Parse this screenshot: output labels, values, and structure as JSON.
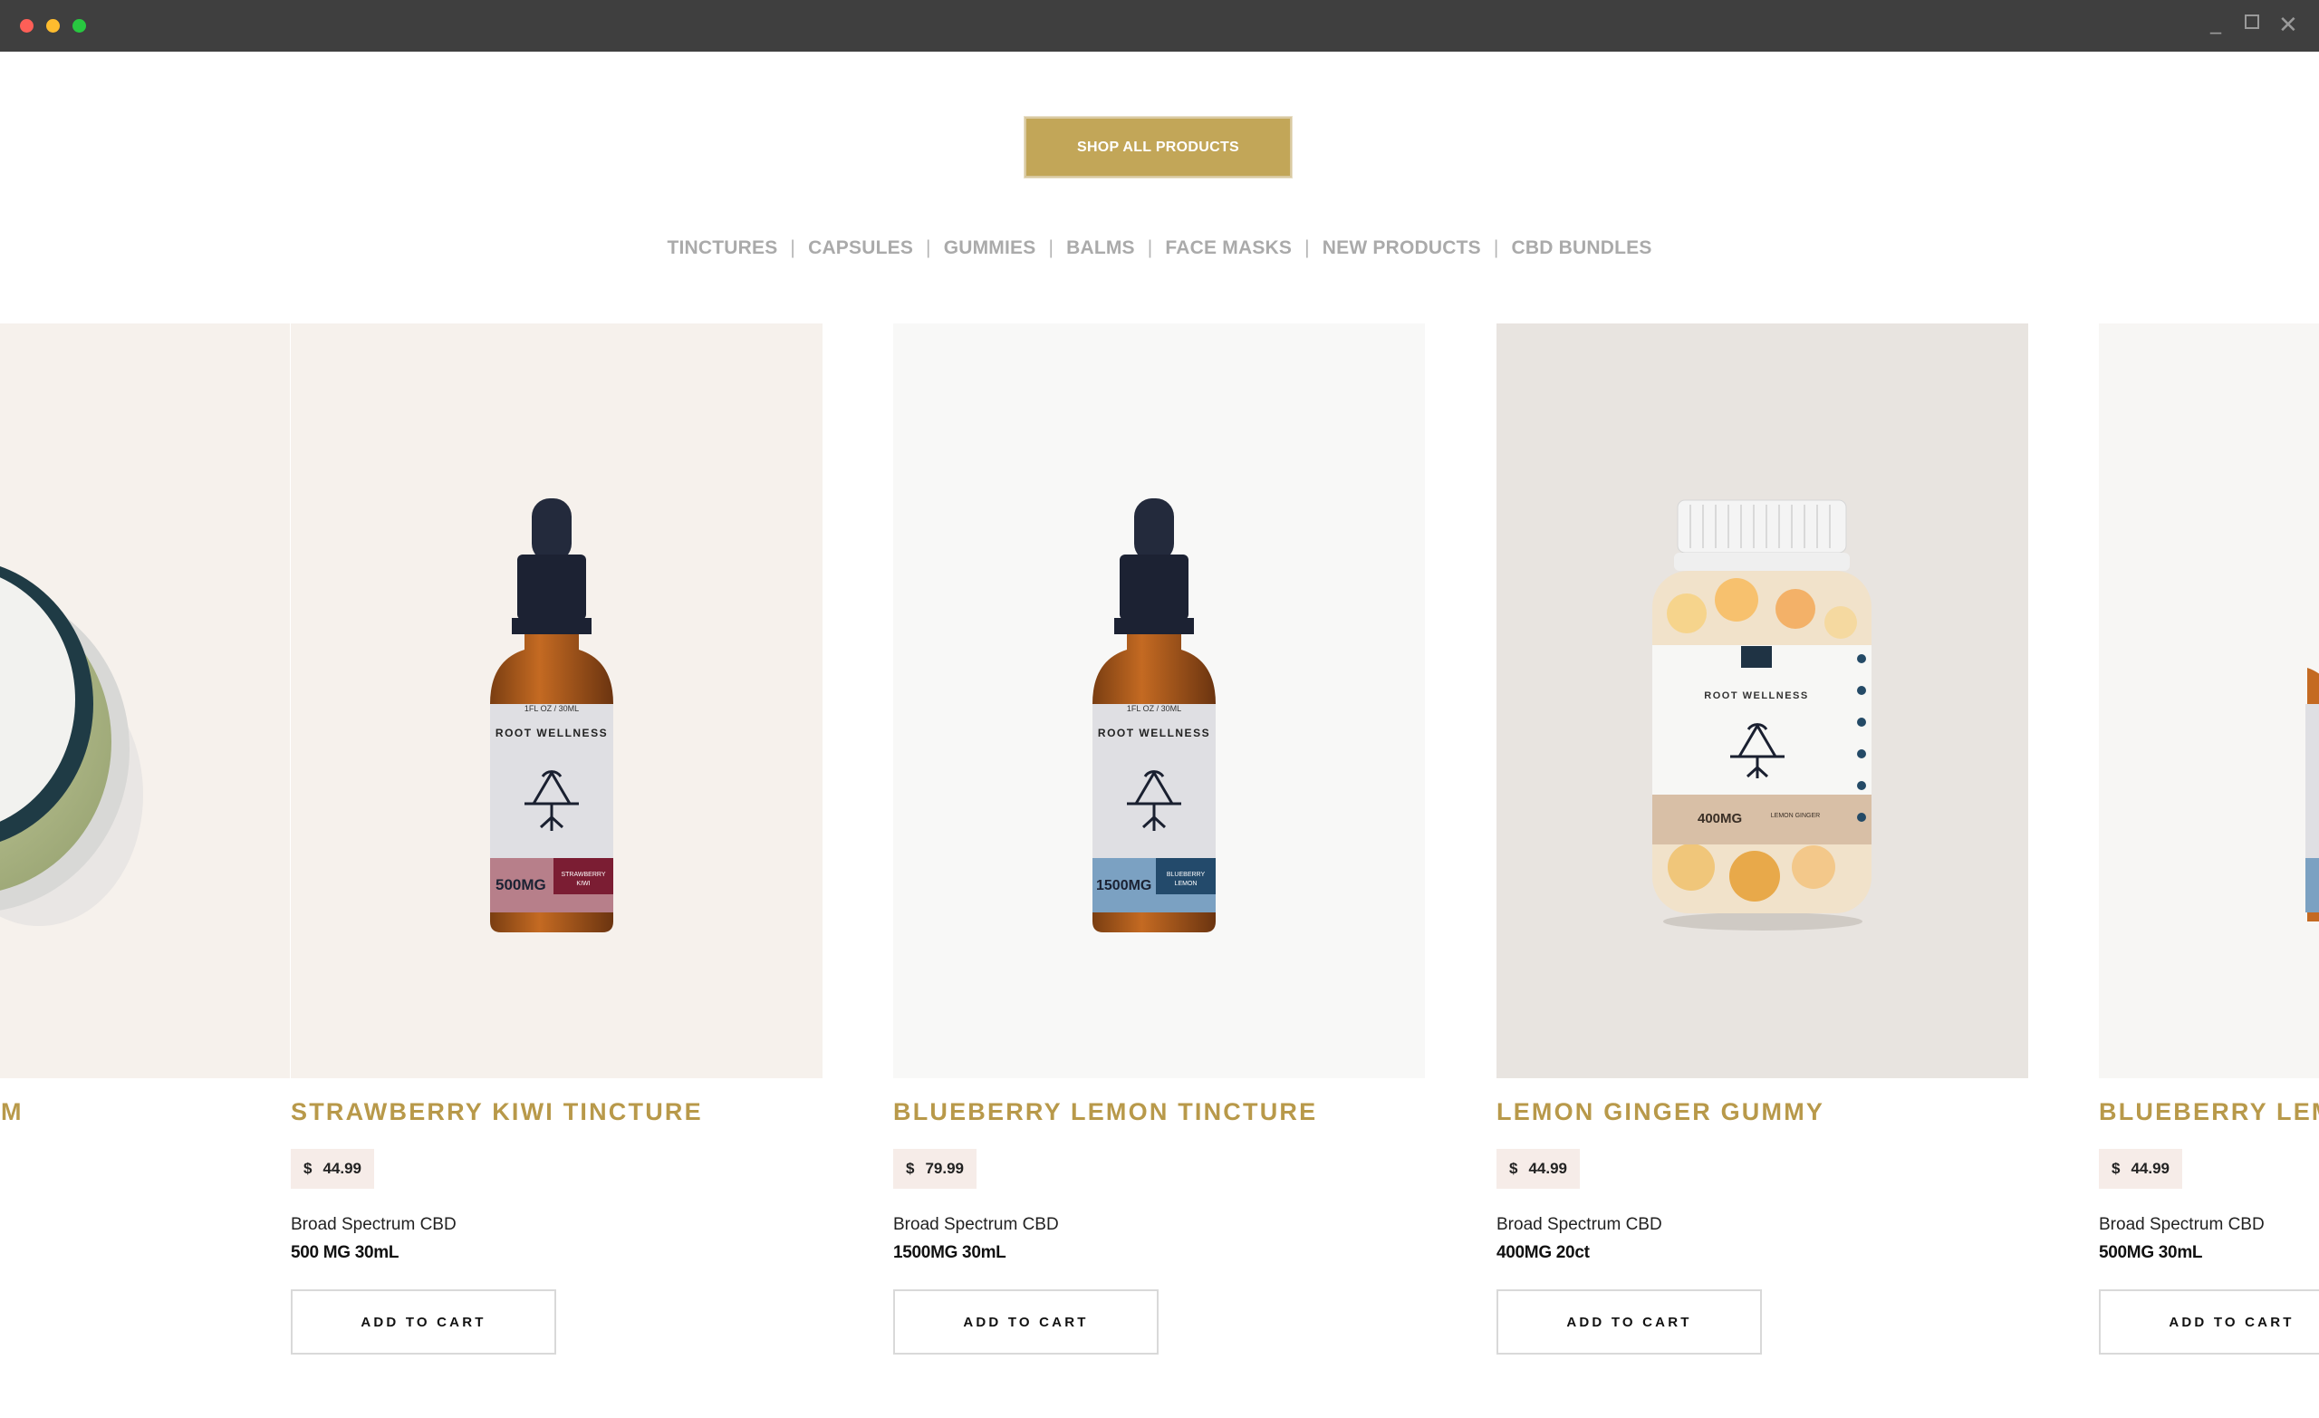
{
  "shop_all_label": "SHOP ALL PRODUCTS",
  "categories": [
    "TINCTURES",
    "CAPSULES",
    "GUMMIES",
    "BALMS",
    "FACE MASKS",
    "NEW PRODUCTS",
    "CBD BUNDLES"
  ],
  "separator": "|",
  "colors": {
    "gold": "#c2a658",
    "name_gold": "#b8994a",
    "price_bg": "#f6ece8"
  },
  "products": [
    {
      "name": "M",
      "partial": true
    },
    {
      "name": "STRAWBERRY KIWI TINCTURE",
      "currency": "$",
      "price": "44.99",
      "subtitle": "Broad Spectrum CBD",
      "size": "500 MG 30mL",
      "cart_label": "ADD TO CART",
      "image": "strawberry-kiwi-tincture-bottle",
      "label_text": "500MG",
      "label_flavor": "STRAWBERRY KIWI"
    },
    {
      "name": "BLUEBERRY LEMON TINCTURE",
      "currency": "$",
      "price": "79.99",
      "subtitle": "Broad Spectrum CBD",
      "size": "1500MG 30mL",
      "cart_label": "ADD TO CART",
      "image": "blueberry-lemon-tincture-bottle",
      "label_text": "1500MG",
      "label_flavor": "BLUEBERRY LEMON"
    },
    {
      "name": "LEMON GINGER GUMMY",
      "currency": "$",
      "price": "44.99",
      "subtitle": "Broad Spectrum CBD",
      "size": "400MG 20ct",
      "cart_label": "ADD TO CART",
      "image": "lemon-ginger-gummy-jar",
      "label_text": "400MG",
      "label_flavor": "LEMON GINGER"
    },
    {
      "name": "BLUEBERRY LEM",
      "currency": "$",
      "price": "44.99",
      "subtitle": "Broad Spectrum CBD",
      "size": "500MG 30mL",
      "cart_label": "ADD TO CART",
      "image": "blueberry-lemon-tincture-bottle"
    }
  ],
  "brand": "ROOT WELLNESS"
}
